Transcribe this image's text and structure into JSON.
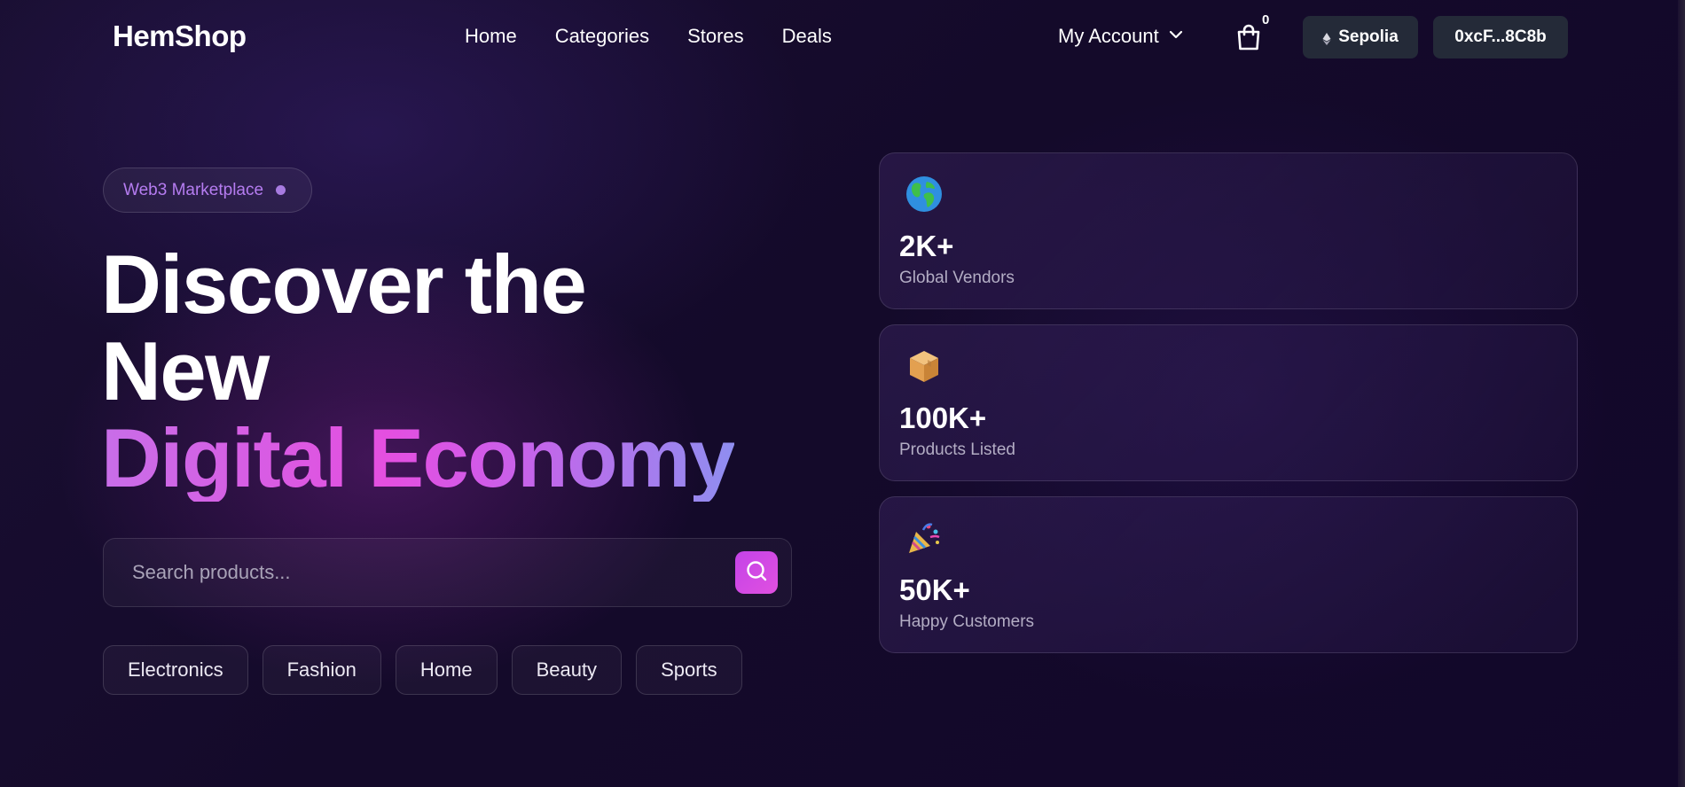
{
  "header": {
    "logo": "HemShop",
    "nav": [
      "Home",
      "Categories",
      "Stores",
      "Deals"
    ],
    "account_label": "My Account",
    "cart_count": "0",
    "network_label": "Sepolia",
    "wallet_label": "0xcF...8C8b"
  },
  "hero": {
    "badge": "Web3 Marketplace",
    "title_line1": "Discover the",
    "title_line2": "New",
    "title_line3": "Digital Economy",
    "search_placeholder": "Search products...",
    "categories": [
      "Electronics",
      "Fashion",
      "Home",
      "Beauty",
      "Sports"
    ]
  },
  "stats": [
    {
      "icon": "globe-icon",
      "value": "2K+",
      "label": "Global Vendors"
    },
    {
      "icon": "package-icon",
      "value": "100K+",
      "label": "Products Listed"
    },
    {
      "icon": "party-popper-icon",
      "value": "50K+",
      "label": "Happy Customers"
    }
  ],
  "colors": {
    "accent": "#d24ee6",
    "badge_text": "#b57cf0",
    "button_bg": "#242a38"
  }
}
